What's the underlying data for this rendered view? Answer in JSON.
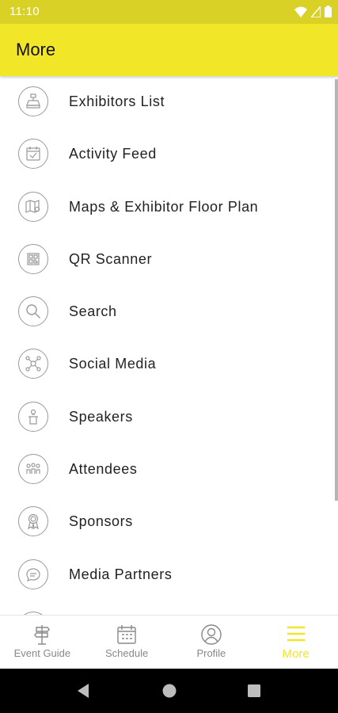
{
  "status_bar": {
    "time": "11:10"
  },
  "header": {
    "title": "More"
  },
  "menu": {
    "items": [
      {
        "label": "Exhibitors List",
        "icon": "exhibitor-icon"
      },
      {
        "label": "Activity Feed",
        "icon": "calendar-check-icon"
      },
      {
        "label": "Maps & Exhibitor Floor Plan",
        "icon": "map-pin-icon"
      },
      {
        "label": "QR Scanner",
        "icon": "qr-code-icon"
      },
      {
        "label": "Search",
        "icon": "search-icon"
      },
      {
        "label": "Social Media",
        "icon": "social-network-icon"
      },
      {
        "label": "Speakers",
        "icon": "speaker-podium-icon"
      },
      {
        "label": "Attendees",
        "icon": "people-group-icon"
      },
      {
        "label": "Sponsors",
        "icon": "award-ribbon-icon"
      },
      {
        "label": "Media Partners",
        "icon": "chat-bubble-icon"
      }
    ]
  },
  "bottom_nav": {
    "items": [
      {
        "label": "Event Guide",
        "icon": "signpost-icon",
        "active": false
      },
      {
        "label": "Schedule",
        "icon": "calendar-grid-icon",
        "active": false
      },
      {
        "label": "Profile",
        "icon": "user-circle-icon",
        "active": false
      },
      {
        "label": "More",
        "icon": "menu-icon",
        "active": true
      }
    ]
  },
  "colors": {
    "accent": "#f2e629",
    "status_bar": "#d9d126",
    "icon_gray": "#9a9a9a"
  }
}
